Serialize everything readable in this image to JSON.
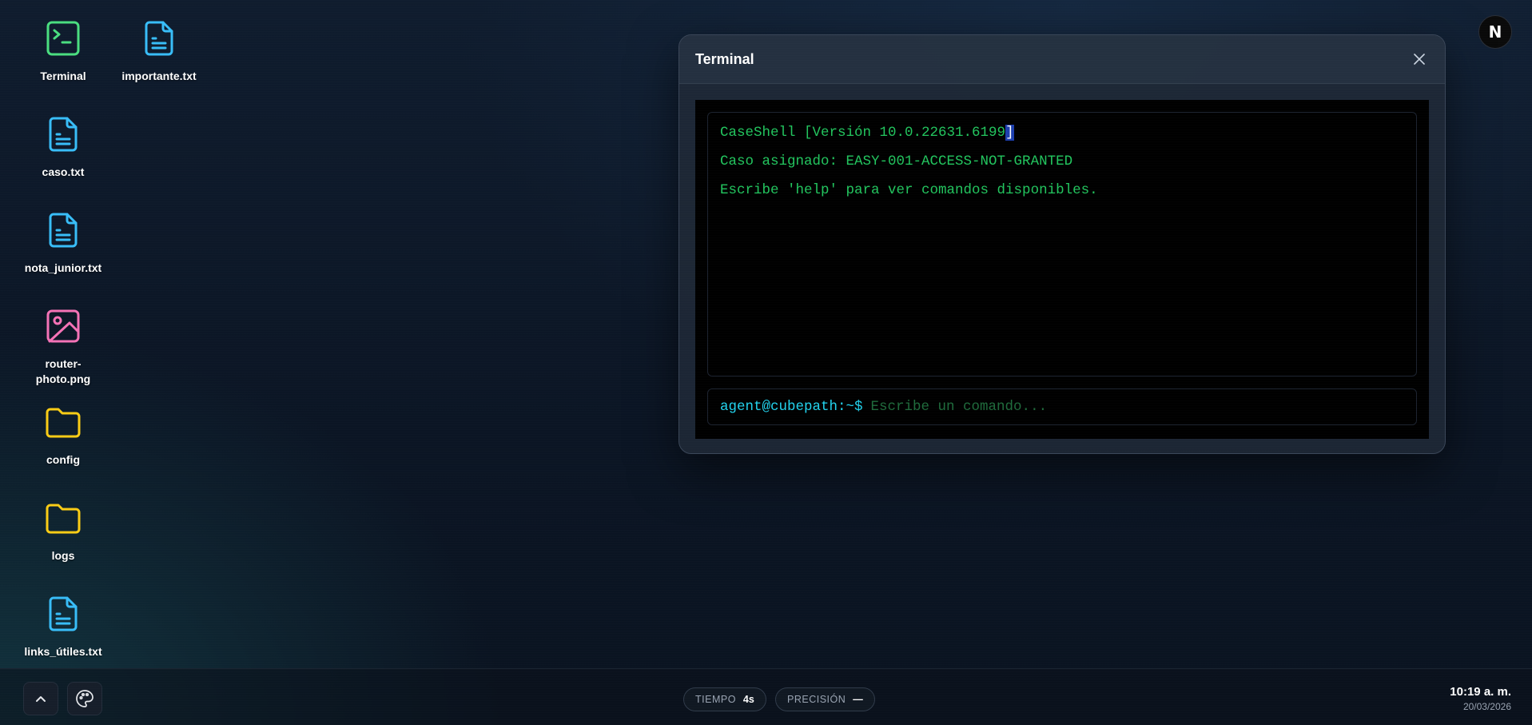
{
  "desktop": {
    "icons": [
      {
        "label": "Terminal",
        "icon": "terminal-icon",
        "color": "#4ade80"
      },
      {
        "label": "importante.txt",
        "icon": "text-file-icon",
        "color": "#38bdf8"
      },
      {
        "label": "caso.txt",
        "icon": "text-file-icon",
        "color": "#38bdf8"
      },
      {
        "label": "nota_junior.txt",
        "icon": "text-file-icon",
        "color": "#38bdf8"
      },
      {
        "label": "router-photo.png",
        "icon": "image-file-icon",
        "color": "#f472b6"
      },
      {
        "label": "config",
        "icon": "folder-icon",
        "color": "#facc15"
      },
      {
        "label": "logs",
        "icon": "folder-icon",
        "color": "#facc15"
      },
      {
        "label": "links_útiles.txt",
        "icon": "text-file-icon",
        "color": "#38bdf8"
      }
    ]
  },
  "user": {
    "avatar_letter": "N"
  },
  "terminal": {
    "title": "Terminal",
    "lines": {
      "line1_pre": "CaseShell [Versión 10.0.22631.6199",
      "line1_hl": "]",
      "line2": "Caso asignado: EASY-001-ACCESS-NOT-GRANTED",
      "line3": "Escribe 'help' para ver comandos disponibles."
    },
    "prompt": "agent@cubepath:~$",
    "input_placeholder": "Escribe un comando...",
    "input_value": ""
  },
  "taskbar": {
    "time_label": "TIEMPO",
    "time_value": "4s",
    "precision_label": "PRECISIÓN",
    "precision_value": "—",
    "clock_time": "10:19 a. m.",
    "clock_date": "20/03/2026"
  },
  "colors": {
    "terminal_green": "#22c55e",
    "prompt_cyan": "#22d3ee",
    "folder_yellow": "#facc15",
    "file_blue": "#38bdf8",
    "image_pink": "#f472b6"
  }
}
